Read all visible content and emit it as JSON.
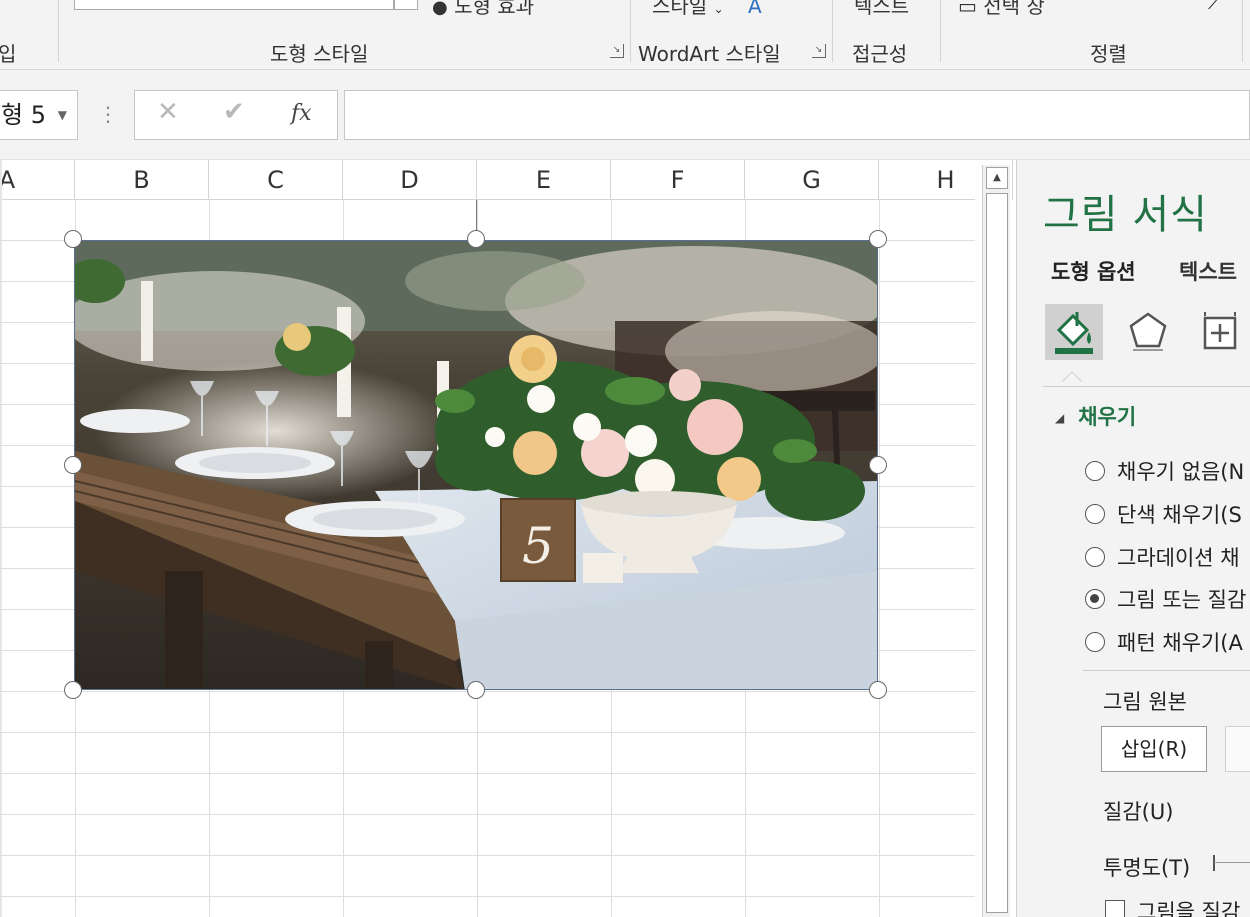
{
  "ribbon": {
    "left_group_fragment": "입",
    "shape_styles_group": "도형 스타일",
    "shape_effects_fragment": "도형 효과",
    "wordart_group": "WordArt 스타일",
    "styles_fragment": "스타일",
    "accessibility_group": "접근성",
    "alt_text_fragment": "텍스트",
    "arrange_group": "정렬",
    "selection_pane_fragment": "선택 창"
  },
  "formula_bar": {
    "name_box_value": "형 5",
    "cancel_symbol": "✕",
    "enter_symbol": "✔",
    "fx_label": "fx",
    "formula_value": ""
  },
  "sheet": {
    "columns": [
      "A",
      "B",
      "C",
      "D",
      "E",
      "F",
      "G",
      "H"
    ]
  },
  "picture": {
    "table_number": "5"
  },
  "task_pane": {
    "title": "그림 서식",
    "tab_shape_options": "도형 옵션",
    "tab_text_options": "텍스트",
    "icons": [
      "fill-line-icon",
      "effects-icon",
      "size-properties-icon"
    ],
    "fill_section": "채우기",
    "fill_options": [
      {
        "label": "채우기 없음(N",
        "checked": false
      },
      {
        "label": "단색 채우기(S",
        "checked": false
      },
      {
        "label": "그라데이션 채",
        "checked": false
      },
      {
        "label": "그림 또는 질감",
        "checked": true
      },
      {
        "label": "패턴 채우기(A",
        "checked": false
      }
    ],
    "picture_source_label": "그림 원본",
    "insert_button": "삽입(R)",
    "texture_label": "질감(U)",
    "transparency_label": "투명도(T)",
    "tile_checkbox_label": "그림을 질감"
  },
  "colors": {
    "accent": "#217346",
    "ribbon_bg": "#f3f3f3",
    "grid_line": "#dedede"
  }
}
